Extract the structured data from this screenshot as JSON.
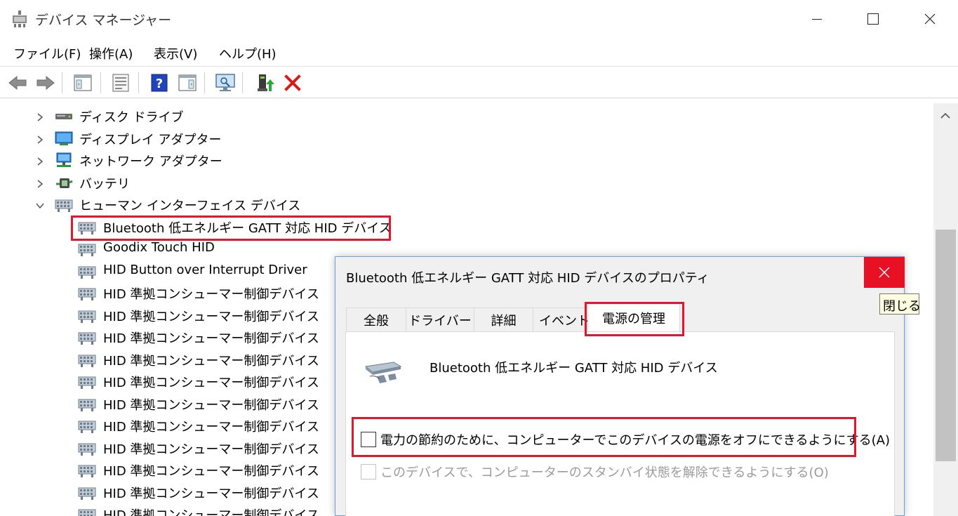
{
  "window": {
    "title": "デバイス マネージャー",
    "minimize": "—",
    "maximize": "☐",
    "close": "✕"
  },
  "menu": [
    "ファイル(F)",
    "操作(A)",
    "表示(V)",
    "ヘルプ(H)"
  ],
  "toolbar": {
    "buttons": [
      "back-arrow",
      "forward-arrow",
      "show-hide-console-tree",
      "properties",
      "help",
      "action-pane",
      "scan-hardware-changes",
      "update-driver",
      "uninstall-device"
    ]
  },
  "tree": {
    "categories": [
      {
        "label": "ディスク ドライブ",
        "expanded": false,
        "icon": "disk-drive-icon"
      },
      {
        "label": "ディスプレイ アダプター",
        "expanded": false,
        "icon": "display-adapter-icon"
      },
      {
        "label": "ネットワーク アダプター",
        "expanded": false,
        "icon": "network-adapter-icon"
      },
      {
        "label": "バッテリ",
        "expanded": false,
        "icon": "battery-icon"
      },
      {
        "label": "ヒューマン インターフェイス デバイス",
        "expanded": true,
        "icon": "hid-icon"
      }
    ],
    "children": [
      "Bluetooth 低エネルギー GATT 対応 HID デバイス",
      "Goodix Touch HID",
      "HID Button over Interrupt Driver",
      "HID 準拠コンシューマー制御デバイス",
      "HID 準拠コンシューマー制御デバイス",
      "HID 準拠コンシューマー制御デバイス",
      "HID 準拠コンシューマー制御デバイス",
      "HID 準拠コンシューマー制御デバイス",
      "HID 準拠コンシューマー制御デバイス",
      "HID 準拠コンシューマー制御デバイス",
      "HID 準拠コンシューマー制御デバイス",
      "HID 準拠コンシューマー制御デバイス",
      "HID 準拠コンシューマー制御デバイス",
      "HID 準拠コンシューマー制御デバイス"
    ],
    "highlighted_index": 0
  },
  "dialog": {
    "title": "Bluetooth 低エネルギー GATT 対応 HID デバイスのプロパティ",
    "close_tooltip": "閉じる",
    "tabs": [
      "全般",
      "ドライバー",
      "詳細",
      "イベント",
      "電源の管理"
    ],
    "active_tab": 4,
    "device_name": "Bluetooth 低エネルギー GATT 対応 HID デバイス",
    "options": [
      {
        "label": "電力の節約のために、コンピューターでこのデバイスの電源をオフにできるようにする(A)",
        "checked": false,
        "enabled": true
      },
      {
        "label": "このデバイスで、コンピューターのスタンバイ状態を解除できるようにする(O)",
        "checked": false,
        "enabled": false
      }
    ]
  },
  "colors": {
    "highlight_red": "#e3162d",
    "close_red": "#e81123",
    "tooltip_bg": "#ffffe1"
  }
}
